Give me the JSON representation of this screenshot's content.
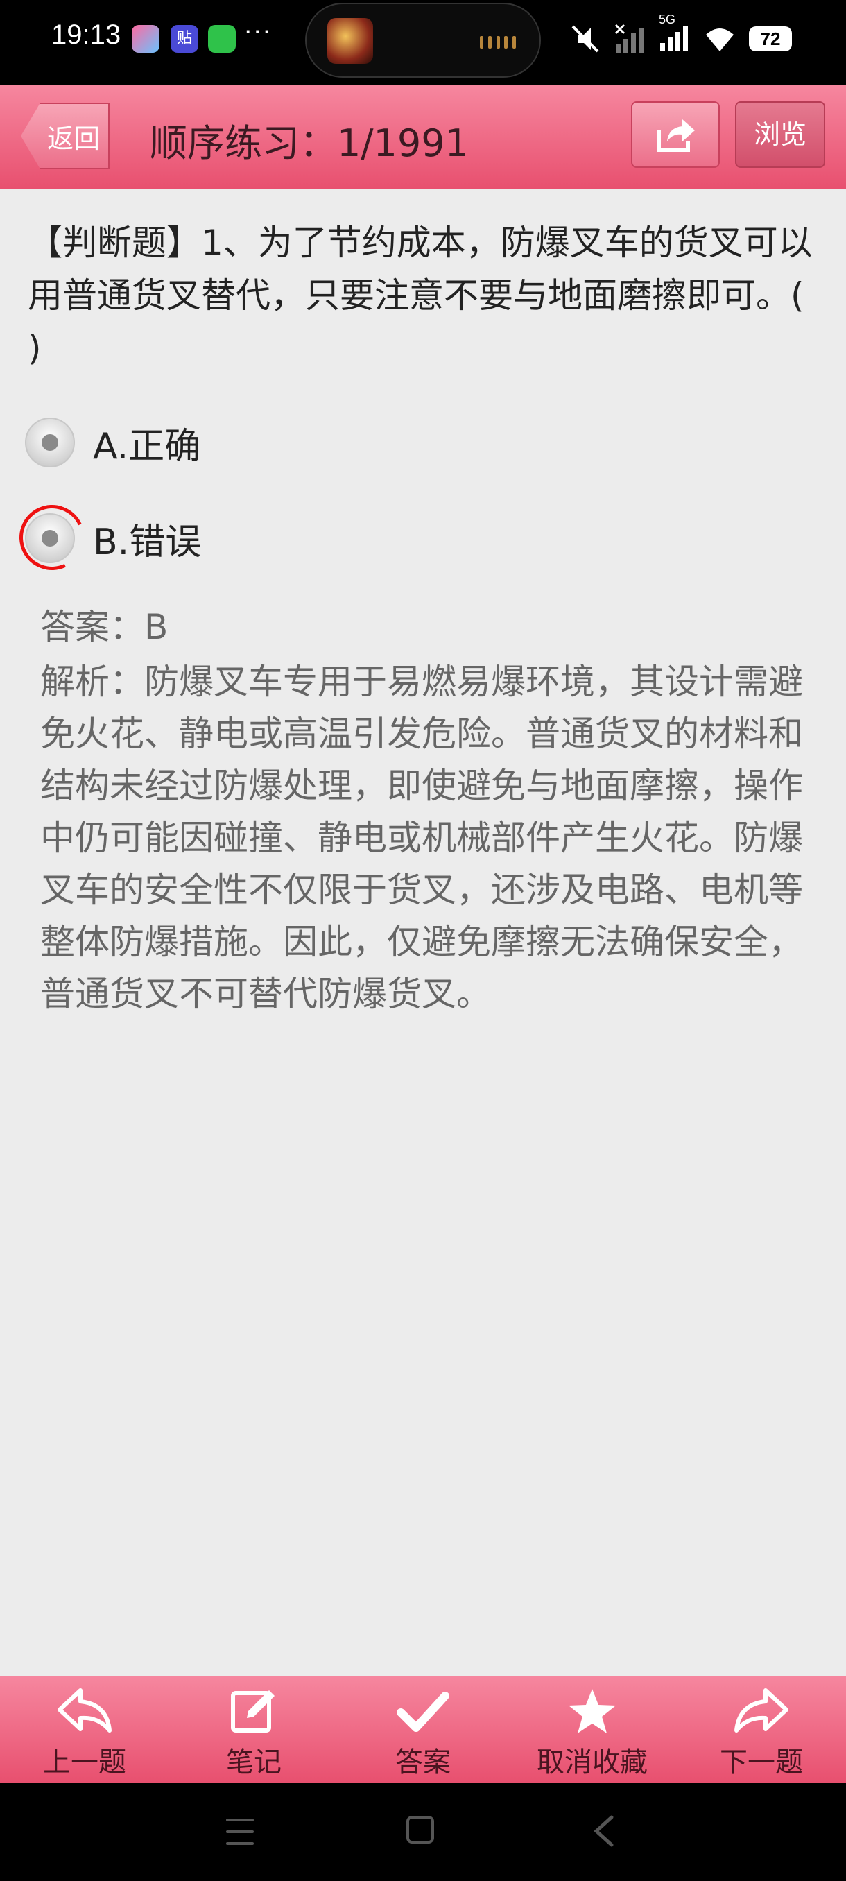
{
  "status_bar": {
    "time": "19:13",
    "more": "···",
    "app_badge": "贴",
    "network": "5G",
    "battery": "72"
  },
  "header": {
    "back_label": "返回",
    "title": "顺序练习：1/1991",
    "browse_label": "浏览"
  },
  "question": {
    "text": "【判断题】1、为了节约成本，防爆叉车的货叉可以用普通货叉替代，只要注意不要与地面磨擦即可。( )"
  },
  "options": [
    {
      "label": "A.正确",
      "selected": false
    },
    {
      "label": "B.错误",
      "selected": true
    }
  ],
  "answer": {
    "label": "答案：B",
    "analysis": "解析：防爆叉车专用于易燃易爆环境，其设计需避免火花、静电或高温引发危险。普通货叉的材料和结构未经过防爆处理，即使避免与地面摩擦，操作中仍可能因碰撞、静电或机械部件产生火花。防爆叉车的安全性不仅限于货叉，还涉及电路、电机等整体防爆措施。因此，仅避免摩擦无法确保安全，普通货叉不可替代防爆货叉。"
  },
  "toolbar": {
    "items": [
      {
        "label": "上一题",
        "icon": "prev-arrow-icon"
      },
      {
        "label": "笔记",
        "icon": "note-edit-icon"
      },
      {
        "label": "答案",
        "icon": "checkmark-icon"
      },
      {
        "label": "取消收藏",
        "icon": "star-icon"
      },
      {
        "label": "下一题",
        "icon": "next-arrow-icon"
      }
    ]
  },
  "colors": {
    "accent": "#e8506f",
    "header_top": "#f6879f",
    "background": "#ececec",
    "selection_ring": "#e11111"
  }
}
